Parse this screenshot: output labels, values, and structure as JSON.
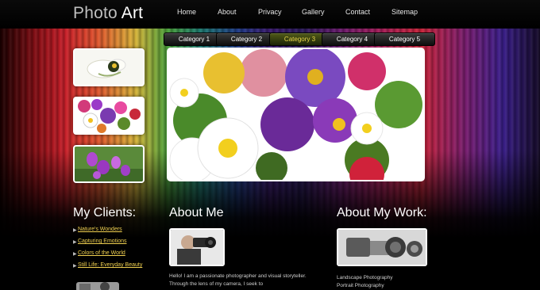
{
  "header": {
    "logo_part1": "Photo ",
    "logo_part2": "Art",
    "nav": [
      "Home",
      "About",
      "Privacy",
      "Gallery",
      "Contact",
      "Sitemap"
    ]
  },
  "categories": {
    "items": [
      "Category 1",
      "Category 2",
      "Category 3",
      "Category 4",
      "Category 5"
    ],
    "active_index": 2
  },
  "clients": {
    "heading": "My Clients:",
    "links": [
      "Nature's Wonders",
      "Capturing Emotions",
      "Colors of the World",
      "Still Life: Everyday Beauty"
    ]
  },
  "about": {
    "heading": "About Me",
    "text": "Hello! I am a passionate photographer and visual storyteller. Through the lens of my camera, I seek to"
  },
  "work": {
    "heading": "About My Work:",
    "items": [
      "Landscape Photography",
      "Portrait Photography"
    ]
  },
  "colors": {
    "accent_link": "#f0d050",
    "active_tab_text": "#e9d64a"
  }
}
